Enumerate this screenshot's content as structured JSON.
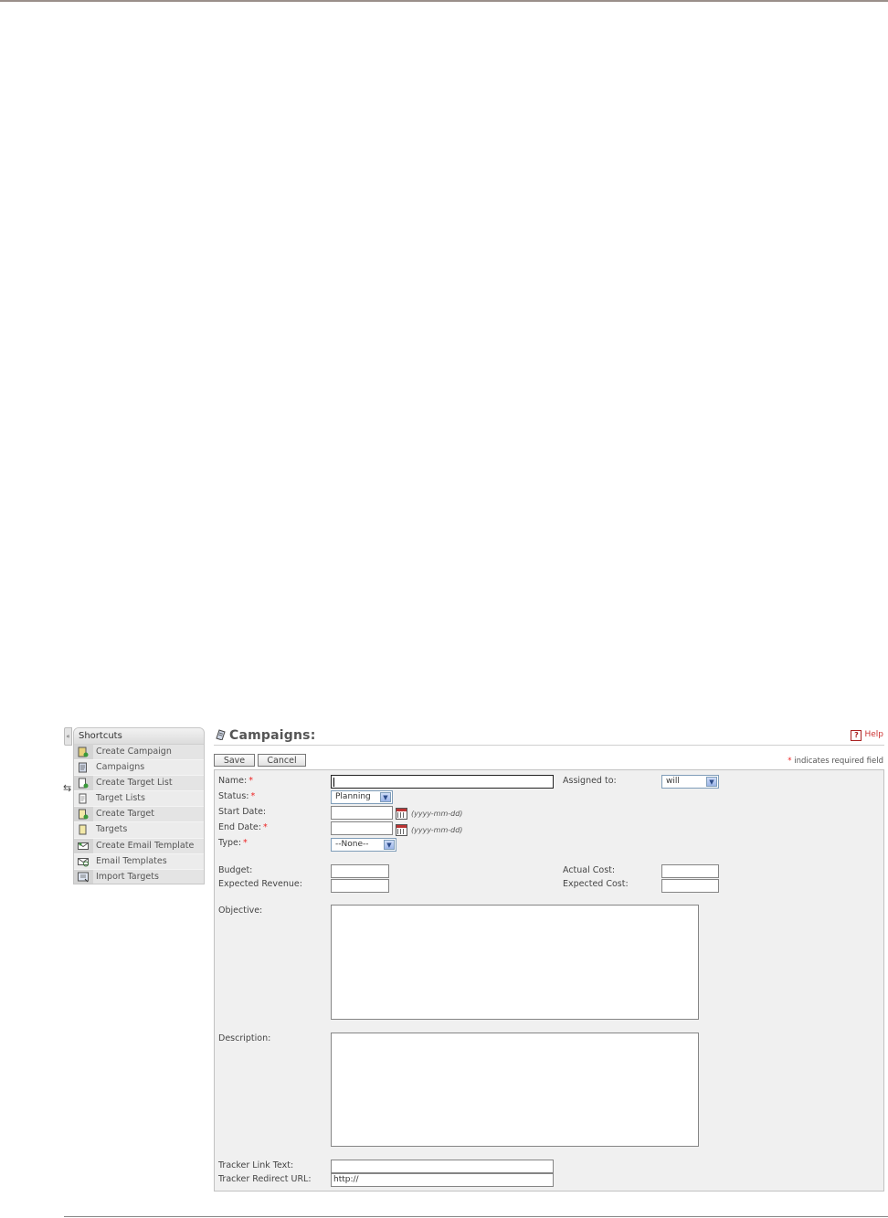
{
  "sidebar": {
    "title": "Shortcuts",
    "items": [
      {
        "label": "Create Campaign",
        "icon": "create-campaign-icon"
      },
      {
        "label": "Campaigns",
        "icon": "campaigns-icon"
      },
      {
        "label": "Create Target List",
        "icon": "create-target-list-icon"
      },
      {
        "label": "Target Lists",
        "icon": "target-lists-icon"
      },
      {
        "label": "Create Target",
        "icon": "create-target-icon"
      },
      {
        "label": "Targets",
        "icon": "targets-icon"
      },
      {
        "label": "Create Email Template",
        "icon": "create-email-template-icon"
      },
      {
        "label": "Email Templates",
        "icon": "email-templates-icon"
      },
      {
        "label": "Import Targets",
        "icon": "import-targets-icon"
      }
    ]
  },
  "header": {
    "title": "Campaigns:",
    "help": "Help",
    "save": "Save",
    "cancel": "Cancel",
    "required_star": "*",
    "required_note": "indicates required field"
  },
  "form": {
    "name_label": "Name:",
    "status_label": "Status:",
    "status_value": "Planning",
    "start_date_label": "Start Date:",
    "end_date_label": "End Date:",
    "date_format_hint": "(yyyy-mm-dd)",
    "type_label": "Type:",
    "type_value": "--None--",
    "assigned_label": "Assigned to:",
    "assigned_value": "will",
    "budget_label": "Budget:",
    "expected_revenue_label": "Expected Revenue:",
    "actual_cost_label": "Actual Cost:",
    "expected_cost_label": "Expected Cost:",
    "objective_label": "Objective:",
    "description_label": "Description:",
    "tracker_link_label": "Tracker Link Text:",
    "tracker_url_label": "Tracker Redirect URL:",
    "tracker_url_value": "http://",
    "required_mark": "*"
  },
  "colors": {
    "required": "#e22222",
    "panel_bg": "#f0f0f0",
    "sidebar_bg": "#e4e4e4"
  }
}
